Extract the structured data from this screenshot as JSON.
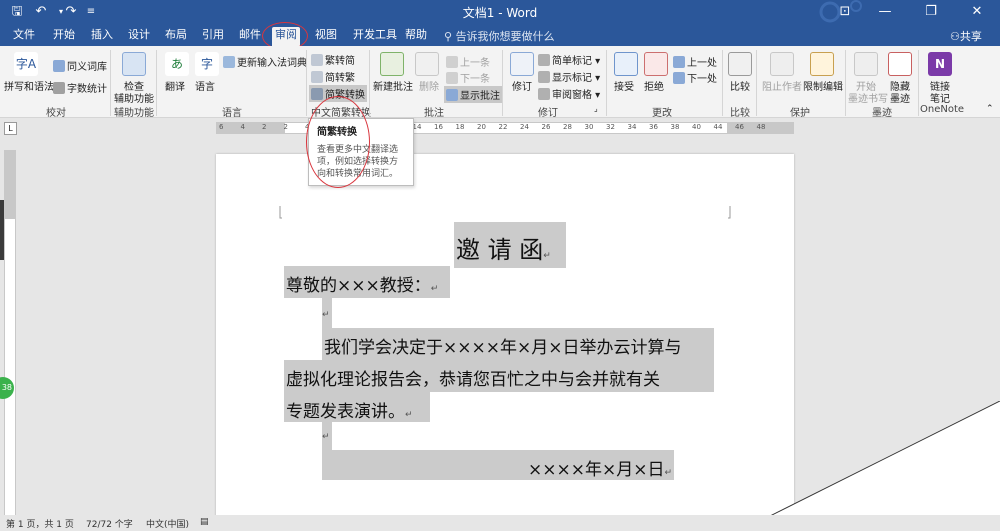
{
  "titlebar": {
    "title": "文档1 - Word",
    "win_min": "—",
    "win_max": "❐",
    "win_close": "✕",
    "ribbon_opts": "⊡"
  },
  "tabs": [
    "文件",
    "开始",
    "插入",
    "设计",
    "布局",
    "引用",
    "邮件",
    "审阅",
    "视图",
    "开发工具",
    "帮助"
  ],
  "active_tab": "审阅",
  "tell_me": "告诉我你想要做什么",
  "share": "共享",
  "ribbon": {
    "proofing": {
      "spell": "拼写和语法",
      "thesaurus": "同义词库",
      "wordcount": "字数统计",
      "label": "校对"
    },
    "access": {
      "check": "检查",
      "check2": "辅助功能",
      "label": "辅助功能"
    },
    "language": {
      "translate": "翻译",
      "lang": "语言",
      "update_ime": "更新输入法词典",
      "label": "语言"
    },
    "chinese": {
      "to_trad": "繁转简",
      "to_simp": "简转繁",
      "convert": "简繁转换",
      "label": "中文简繁转换"
    },
    "comments": {
      "new": "新建批注",
      "delete": "删除",
      "prev": "上一条",
      "next": "下一条",
      "show": "显示批注",
      "label": "批注"
    },
    "tracking": {
      "track": "修订",
      "simple_markup": "简单标记",
      "show_markup": "显示标记",
      "review_pane": "审阅窗格",
      "label": "修订"
    },
    "changes": {
      "accept": "接受",
      "reject": "拒绝",
      "prev": "上一处",
      "next": "下一处",
      "label": "更改"
    },
    "compare": {
      "compare": "比较",
      "label": "比较"
    },
    "protect": {
      "block": "阻止作者",
      "restrict": "限制编辑",
      "label": "保护"
    },
    "ink": {
      "start": "开始",
      "start2": "墨迹书写",
      "hide": "隐藏",
      "hide2": "墨迹",
      "label": "墨迹"
    },
    "onenote": {
      "link": "链接",
      "link2": "笔记",
      "label": "OneNote"
    }
  },
  "tooltip": {
    "title": "简繁转换",
    "body": "查看更多中文翻译选项，例如选择转换方向和转换常用词汇。"
  },
  "ruler_marks": [
    "6",
    "4",
    "2",
    "2",
    "4",
    "6",
    "8",
    "10",
    "12",
    "14",
    "16",
    "18",
    "20",
    "22",
    "24",
    "26",
    "28",
    "30",
    "32",
    "34",
    "36",
    "38",
    "40",
    "44",
    "46",
    "48"
  ],
  "document": {
    "title": "邀 请 函",
    "greeting": "尊敬的×××教授：",
    "body_line1": "我们学会决定于××××年×月×日举办云计算与",
    "body_line2": "虚拟化理论报告会，恭请您百忙之中与会并就有关",
    "body_line3": "专题发表演讲。",
    "date": "××××年×月×日",
    "para_mark": "↵"
  },
  "status": {
    "page": "第 1 页，共 1 页",
    "words": "72/72 个字",
    "lang": "中文(中国)",
    "badge": "38"
  },
  "colors": {
    "brand": "#2b579a",
    "annotation": "#d9363e",
    "highlight": "#cbcbcb"
  }
}
